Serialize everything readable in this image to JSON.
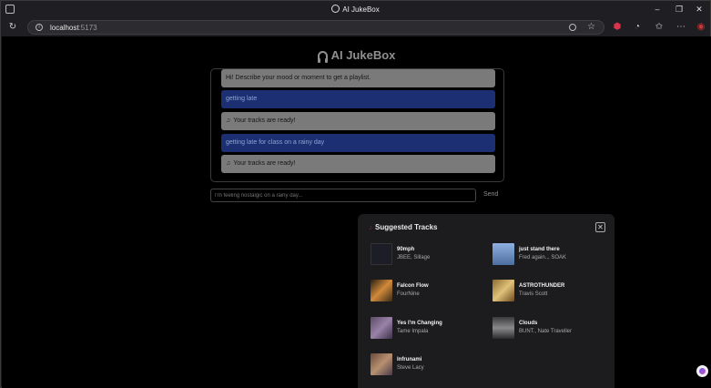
{
  "browser": {
    "tab_title": "AI JukeBox",
    "url_host": "localhost",
    "url_port": ":5173"
  },
  "app": {
    "title": "AI JukeBox"
  },
  "chat": {
    "messages": [
      {
        "role": "bot",
        "text": "Hi! Describe your mood or moment to get a playlist."
      },
      {
        "role": "user",
        "text": "getting late"
      },
      {
        "role": "bot",
        "text": "Your tracks are ready!",
        "icon": "music-note-icon"
      },
      {
        "role": "user",
        "text": "getting late for class on a rainy day"
      },
      {
        "role": "bot",
        "text": "Your tracks are ready!",
        "icon": "music-note-icon"
      }
    ],
    "input_placeholder": "I'm feeling nostalgic on a rainy day...",
    "send_label": "Send"
  },
  "suggested": {
    "title": "Suggested Tracks",
    "close_label": "✕",
    "tracks": [
      {
        "name": "90mph",
        "artist": "JBEE, Sillage",
        "art_color": "#1d1d28"
      },
      {
        "name": "just stand there",
        "artist": "Fred again.., SOAK",
        "art_color": "#6f8fc4"
      },
      {
        "name": "Falcon Flow",
        "artist": "FourNine",
        "art_color": "#b86a2a"
      },
      {
        "name": "ASTROTHUNDER",
        "artist": "Travis Scott",
        "art_color": "#c69c48"
      },
      {
        "name": "Yes I'm Changing",
        "artist": "Tame Impala",
        "art_color": "#6e5a78"
      },
      {
        "name": "Clouds",
        "artist": "BUNT., Nate Traveller",
        "art_color": "#5e5e60"
      },
      {
        "name": "Infrunami",
        "artist": "Steve Lacy",
        "art_color": "#8c6a5a"
      }
    ]
  }
}
